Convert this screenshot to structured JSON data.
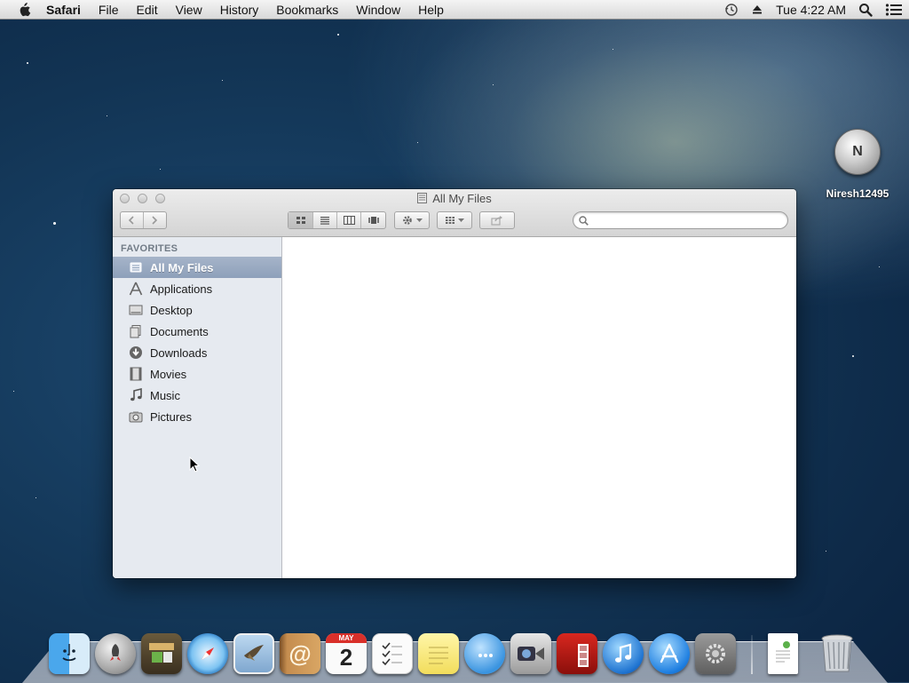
{
  "menubar": {
    "app_name": "Safari",
    "items": [
      "File",
      "Edit",
      "View",
      "History",
      "Bookmarks",
      "Window",
      "Help"
    ],
    "clock": "Tue 4:22 AM",
    "status_icons": [
      "time-machine-icon",
      "eject-icon",
      "spotlight-search-icon",
      "notification-center-icon"
    ]
  },
  "desktop": {
    "icon_label": "Niresh12495",
    "icon_glyph": "N"
  },
  "window": {
    "title": "All My Files",
    "search": {
      "value": "",
      "placeholder": ""
    },
    "sidebar": {
      "heading": "FAVORITES",
      "items": [
        {
          "label": "All My Files",
          "icon": "all-my-files-icon",
          "selected": true
        },
        {
          "label": "Applications",
          "icon": "applications-icon",
          "selected": false
        },
        {
          "label": "Desktop",
          "icon": "desktop-icon",
          "selected": false
        },
        {
          "label": "Documents",
          "icon": "documents-icon",
          "selected": false
        },
        {
          "label": "Downloads",
          "icon": "downloads-icon",
          "selected": false
        },
        {
          "label": "Movies",
          "icon": "movies-icon",
          "selected": false
        },
        {
          "label": "Music",
          "icon": "music-icon",
          "selected": false
        },
        {
          "label": "Pictures",
          "icon": "pictures-icon",
          "selected": false
        }
      ]
    }
  },
  "dock": {
    "calendar": {
      "month": "MAY",
      "day": "2"
    },
    "icons": [
      "finder",
      "launchpad",
      "photo-browser",
      "safari",
      "mail",
      "contacts",
      "calendar",
      "reminders",
      "notes",
      "messages",
      "facetime",
      "photo-booth",
      "itunes",
      "app-store",
      "system-preferences",
      "documents-stack",
      "trash"
    ]
  },
  "colors": {
    "sidebar_bg": "#e6eaf0",
    "sidebar_selected": "#8ea0ba",
    "menubar_bg": "#e6e6e6",
    "desktop_bg": "#123454"
  }
}
